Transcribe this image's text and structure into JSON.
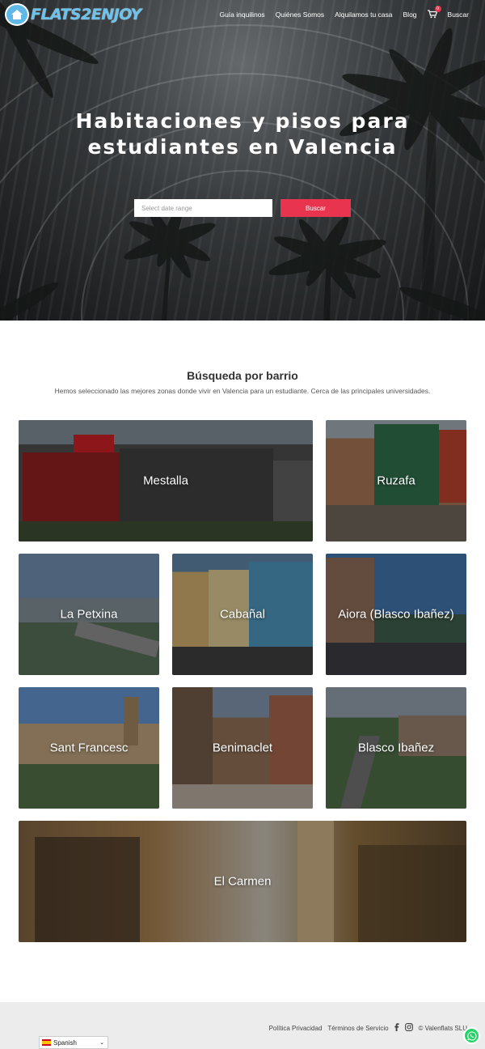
{
  "header": {
    "logo_text": "FLATS2ENJOY",
    "nav": [
      "Guía inquilinos",
      "Quiénes Somos",
      "Alquilamos tu casa",
      "Blog",
      "Buscar"
    ],
    "cart_count": "0"
  },
  "hero": {
    "title_line1": "Habitaciones y pisos para",
    "title_line2": "estudiantes en Valencia",
    "date_placeholder": "Select date range",
    "search_label": "Buscar"
  },
  "section": {
    "title": "Búsqueda por barrio",
    "subtitle": "Hemos seleccionado las mejores zonas donde vivir en Valencia para un estudiante. Cerca de las principales universidades."
  },
  "neighborhoods": [
    "Mestalla",
    "Ruzafa",
    "La Petxina",
    "Cabañal",
    "Aiora (Blasco Ibañez)",
    "Sant Francesc",
    "Benimaclet",
    "Blasco Ibañez",
    "El Carmen"
  ],
  "footer": {
    "privacy": "Política Privacidad",
    "terms": "Términos de Servicio",
    "copyright": "© Valenflats SLU",
    "language": "Spanish"
  },
  "colors": {
    "accent": "#e8344e",
    "logo": "#6cc3ee",
    "footer_bg": "#ececec",
    "whatsapp": "#25d366"
  }
}
